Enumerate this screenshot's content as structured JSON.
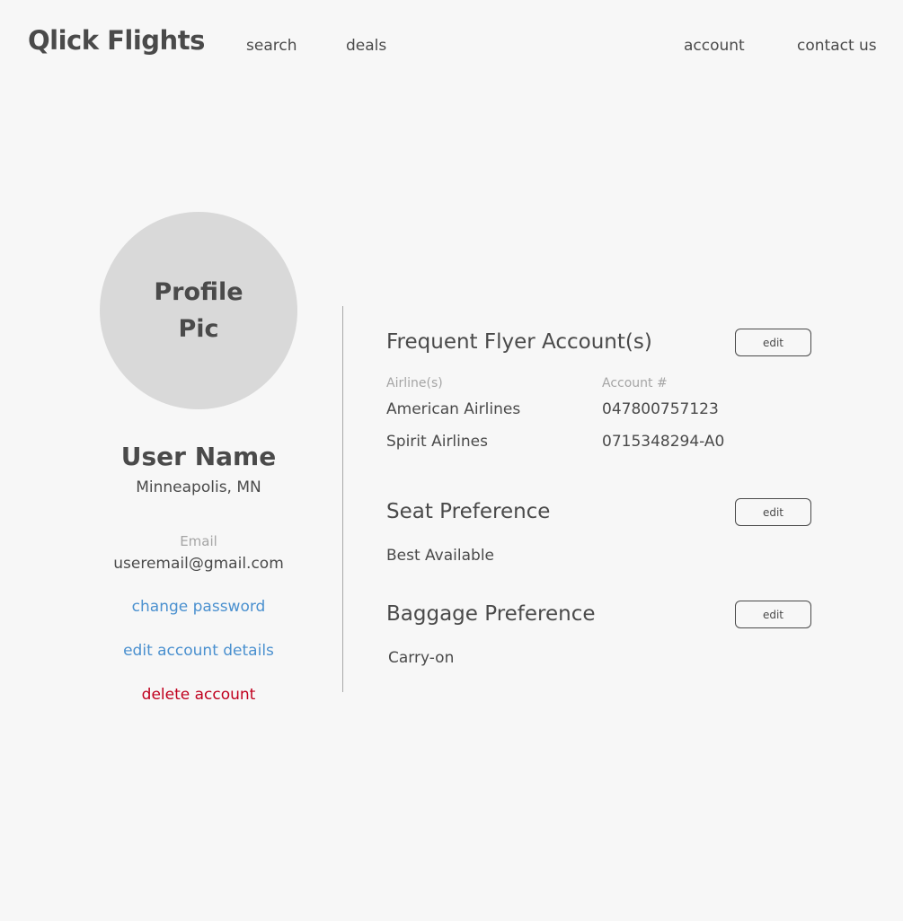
{
  "header": {
    "brand": "Qlick Flights",
    "nav": {
      "search": "search",
      "deals": "deals",
      "account": "account",
      "contact": "contact us"
    }
  },
  "profile": {
    "avatar_text": "Profile Pic",
    "name": "User Name",
    "location": "Minneapolis, MN",
    "email_label": "Email",
    "email": "useremail@gmail.com",
    "links": {
      "change_password": "change password",
      "edit_account_details": "edit account details",
      "delete_account": "delete account"
    }
  },
  "frequent_flyer": {
    "title": "Frequent Flyer Account(s)",
    "edit_label": "edit",
    "columns": [
      "Airline(s)",
      "Account #"
    ],
    "rows": [
      {
        "airline": "American Airlines",
        "account": "047800757123"
      },
      {
        "airline": "Spirit Airlines",
        "account": "0715348294-A0"
      }
    ]
  },
  "seat_preference": {
    "title": "Seat Preference",
    "edit_label": "edit",
    "value": "Best Available"
  },
  "baggage_preference": {
    "title": "Baggage Preference",
    "edit_label": "edit",
    "value": "Carry-on"
  },
  "colors": {
    "background": "#f7f7f7",
    "text": "#4a4a4a",
    "muted": "#a5a5a5",
    "avatar": "#d9d9d9",
    "link": "#4a90cf",
    "danger": "#c0001e"
  }
}
